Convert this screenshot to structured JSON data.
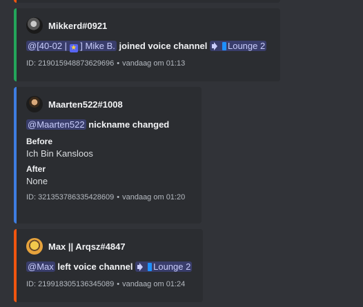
{
  "embeds": [
    {
      "author": "Mikkerd#0921",
      "mention": "@[40-02 | ",
      "mention_star": "★",
      "mention_rest": " ] Mike B.",
      "action": "joined voice channel",
      "channel": "Lounge 2",
      "id_text": "ID: 219015948873629696",
      "time": "vandaag om 01:13",
      "color": "#23a55a"
    },
    {
      "author": "Maarten522#1008",
      "mention": "@Maarten522",
      "action": "nickname changed",
      "before_label": "Before",
      "before_value": "Ich Bin Kansloos",
      "after_label": "After",
      "after_value": "None",
      "id_text": "ID: 321353786335428609",
      "time": "vandaag om 01:20",
      "color": "#3e7de0"
    },
    {
      "author": "Max || Arqsz#4847",
      "mention": "@Max",
      "action": "left voice channel",
      "channel": "Lounge 2",
      "id_text": "ID: 219918305136345089",
      "time": "vandaag om 01:24",
      "color": "#f0550f"
    }
  ],
  "separator": "•",
  "icons": [
    "avatar",
    "speaker-icon",
    "phone-icon",
    "star-icon"
  ]
}
